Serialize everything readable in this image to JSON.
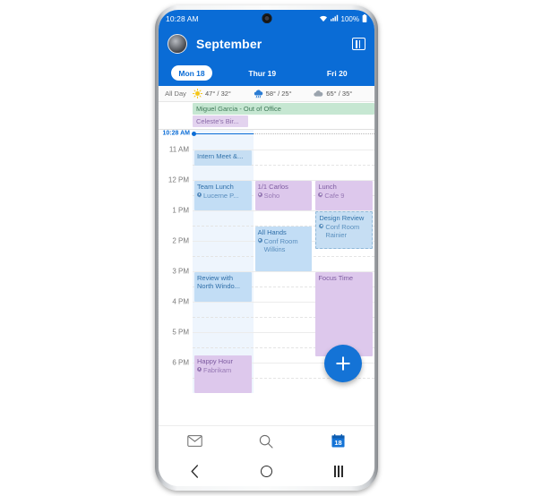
{
  "status_bar": {
    "time": "10:28 AM",
    "wifi_icon": "wifi-icon",
    "signal_icon": "cellular-signal-icon",
    "battery_text": "100%",
    "battery_icon": "battery-full-icon"
  },
  "header": {
    "avatar": "user-avatar",
    "title": "September",
    "view_toggle_icon": "multi-day-view-icon"
  },
  "day_tabs": [
    {
      "label": "Mon 18",
      "active": true
    },
    {
      "label": "Thur 19",
      "active": false
    },
    {
      "label": "Fri 20",
      "active": false
    }
  ],
  "all_day": {
    "label": "All Day",
    "weather": [
      {
        "icon": "sun-icon",
        "temps": "47° / 32°"
      },
      {
        "icon": "rain-cloud-icon",
        "temps": "58° / 25°"
      },
      {
        "icon": "cloud-icon",
        "temps": "65° / 35°"
      }
    ],
    "events": [
      {
        "title": "Miguel Garcia - Out of Office",
        "color": "#c6e7d2"
      },
      {
        "title": "Celeste's Bir...",
        "color": "#e3d3ef"
      }
    ]
  },
  "now_indicator": {
    "label": "10:28 AM",
    "color": "#0a6cd6"
  },
  "hours": [
    "11 AM",
    "12 PM",
    "1 PM",
    "2 PM",
    "3 PM",
    "4 PM",
    "5 PM",
    "6 PM"
  ],
  "events": {
    "intern_meet": {
      "title": "Intern Meet &...",
      "location": ""
    },
    "team_lunch": {
      "title": "Team Lunch",
      "location": "Lucerne P..."
    },
    "one_on_one_carlos": {
      "title": "1/1 Carlos",
      "location": "Soho"
    },
    "lunch": {
      "title": "Lunch",
      "location": "Cafe 9"
    },
    "design_review": {
      "title": "Design Review",
      "location": "Conf Room Rainier"
    },
    "all_hands": {
      "title": "All Hands",
      "location": "Conf Room Wilkins"
    },
    "review_north_wind": {
      "title": "Review with North Windo...",
      "location": ""
    },
    "focus_time": {
      "title": "Focus Time",
      "location": ""
    },
    "happy_hour": {
      "title": "Happy Hour",
      "location": "Fabrikam"
    }
  },
  "fab": {
    "icon": "plus-icon",
    "color": "#1473d6"
  },
  "bottom_nav": [
    {
      "icon": "mail-icon",
      "active": false
    },
    {
      "icon": "search-icon",
      "active": false
    },
    {
      "icon": "calendar-18-icon",
      "active": true,
      "badge": "18"
    }
  ],
  "system_nav": [
    {
      "icon": "back-icon"
    },
    {
      "icon": "home-icon"
    },
    {
      "icon": "recents-icon"
    }
  ]
}
